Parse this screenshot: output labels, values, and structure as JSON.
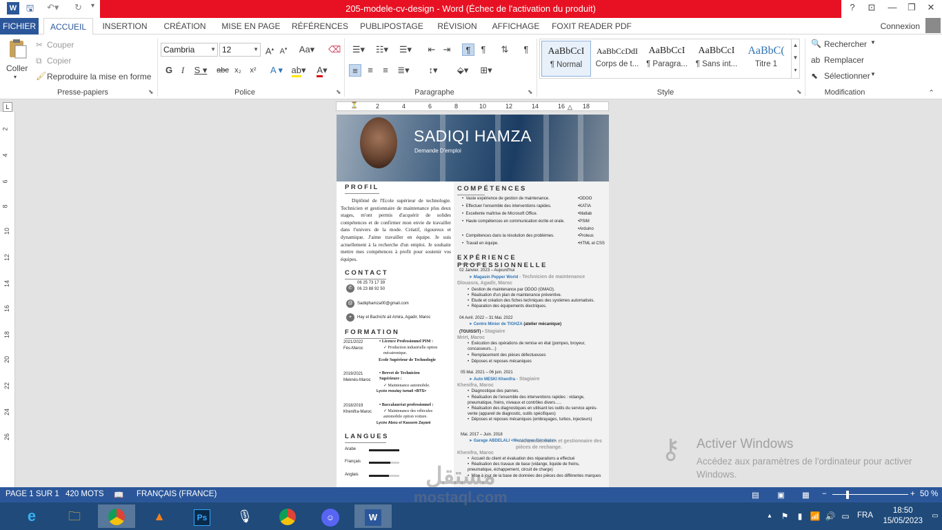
{
  "titlebar": {
    "title": "205-modele-cv-design -  Word (Échec de l'activation du produit)",
    "help": "?",
    "restore_ribbon": "⊡",
    "minimize": "—",
    "maximize": "❐",
    "close": "✕"
  },
  "tabs": {
    "file": "FICHIER",
    "items": [
      "ACCUEIL",
      "INSERTION",
      "CRÉATION",
      "MISE EN PAGE",
      "RÉFÉRENCES",
      "PUBLIPOSTAGE",
      "RÉVISION",
      "AFFICHAGE",
      "FOXIT READER PDF"
    ],
    "active": "ACCUEIL",
    "signin": "Connexion"
  },
  "ribbon": {
    "clipboard": {
      "paste": "Coller",
      "cut": "Couper",
      "copy": "Copier",
      "format_painter": "Reproduire la mise en forme",
      "label": "Presse-papiers"
    },
    "font": {
      "name": "Cambria",
      "size": "12",
      "label": "Police"
    },
    "paragraph": {
      "label": "Paragraphe"
    },
    "styles": {
      "label": "Style",
      "items": [
        {
          "sample": "AaBbCcI",
          "name": "¶ Normal"
        },
        {
          "sample": "AaBbCcDdI",
          "name": "Corps de t..."
        },
        {
          "sample": "AaBbCcI",
          "name": "¶ Paragra..."
        },
        {
          "sample": "AaBbCcI",
          "name": "¶ Sans int..."
        },
        {
          "sample": "AaBbC(",
          "name": "Titre 1"
        }
      ]
    },
    "editing": {
      "find": "Rechercher",
      "replace": "Remplacer",
      "select": "Sélectionner",
      "label": "Modification"
    }
  },
  "ruler": {
    "h_numbers": [
      "2",
      "4",
      "6",
      "8",
      "10",
      "12",
      "14",
      "16",
      "18"
    ],
    "v_numbers": [
      "2",
      "4",
      "6",
      "8",
      "10",
      "12",
      "14",
      "16",
      "18",
      "20",
      "22",
      "24",
      "26"
    ]
  },
  "cv": {
    "name": "SADIQI HAMZA",
    "subtitle": "Demande D'emploi",
    "profil_h": "PROFIL",
    "profil_text": "Diplômé de l'Ecole supérieur de technologie. Technicien et gestionnaire de maintenance plus deux stages, m'ont permis d'acquérir de solides compétences et de confirmer mon envie de travailler dans l'univers de la mode. Créatif, rigoureux et dynamique. J'aime travailler en équipe. Je suis actuellement à la recherche d'un emploi. Je souhaite mettre mes compétences à profit pour soutenir vos équipes.",
    "contact_h": "CONTACT",
    "phone1": "06 25 73 17 39",
    "phone2": "06 23 88 92 50",
    "email": "Sadiqihamza00@gmail.com",
    "address": "Hay el Bachichi ait Amira, Agadir, Maroc",
    "formation_h": "FORMATION",
    "formation": [
      {
        "years": "2021/2022",
        "place": "Fès-Maroc",
        "title": "Licence Professionnel PIM :",
        "detail": "Production industrielle option mécatronique.",
        "school": "Ecole Supérieur de Technologie"
      },
      {
        "years": "2019/2021",
        "place": "Meknès-Maroc",
        "title": "Brevet de Technicien Supérieure :",
        "detail": "Maintenance automobile.",
        "school": "Lycée moulay ismail <BTS>"
      },
      {
        "years": "2018/2019",
        "place": "Khenifra-Maroc",
        "title": "Baccalauréat professionnel :",
        "detail": "Maintenance des véhicules automobile option voiture.",
        "school": "Lycée Abou el Kassem Zayani"
      }
    ],
    "langues_h": "LANGUES",
    "langues": [
      {
        "name": "Arabe",
        "level": 1.0
      },
      {
        "name": "Français",
        "level": 0.7
      },
      {
        "name": "Anglais",
        "level": 0.65
      }
    ],
    "competences_h": "COMPÉTENCES",
    "competences": [
      "Vaste expérience de gestion de maintenance.",
      "Effectuer l'ensemble des interventions rapides.",
      "Excellente maîtrise de Microsoft Office.",
      "Haute compétences en communication écrite et orale.",
      "Compétences dans la résolution des problèmes.",
      "Travail en équipe."
    ],
    "tools": [
      "ODOO",
      "KATIA",
      "Matlab",
      "PSIM",
      "Arduino",
      "Proteus",
      "HTML et CSS"
    ],
    "experience_h": "EXPÉRIENCE PROFESSIONNELLE",
    "experiences": [
      {
        "dates": "02 Janvier. 2023 – Aujourd'hui",
        "company": "Magasin Pepper World",
        "role": "- Technicien de maintenance",
        "location": "Dlouasra, Agadir, Maroc",
        "tasks": [
          "Gestion de maintenance par ODOO (GMAO).",
          "Réalisation d'un plan de maintenance préventive.",
          "Etude et création des fiches techniques des systèmes automatisés.",
          "Réparation des équipements électriques."
        ]
      },
      {
        "dates": "04 Avril. 2022 – 31 Mai. 2022",
        "company": "Centre Minier de TIGHZA",
        "company_extra": "(atelier mécanique)",
        "extra2": "(TOUISSIT) -",
        "role": "Stagiaire",
        "location": "Mrirt, Maroc",
        "tasks": [
          "Exécution des opérations de remise en état (pompes, broyeur, concasseurs…)",
          "Remplacement des pièces défectueuses",
          "Déposes et reposes mécaniques"
        ]
      },
      {
        "dates": "05 Mai. 2021 – 06 juin. 2021",
        "company": "Auto MESKI Khenifra",
        "role": "- Stagiaire",
        "location": "Khenifra, Maroc",
        "tasks": [
          "Diagnostique des pannes.",
          "Réalisation de l'ensemble des interventions rapides : vidange, pneumatique, freins, niveaux et contrôles divers…..",
          "Réalisation des diagnostiques en utilisant les outils du service après-vente (appareil de diagnostic, outils spécifiques)",
          "Déposes et reposes mécaniques (embrayages, turbos, injecteurs)"
        ]
      },
      {
        "dates": "Mai. 2017 – Juin. 2018",
        "company": "Garage ABDELALI <Mecanique Générale>",
        "role": "- Aide mécanicien et gestionnaire des pièces de rechange.",
        "location": "Khenifra, Maroc",
        "tasks": [
          "Accueil du client et évaluation des réparations a effectué",
          "Réalisation des travaux de base (vidange, liquide de freins, pneumatique, échappement, circuit de charge)",
          "Mise à jour de la base de données des pièces des différentes marques"
        ]
      }
    ]
  },
  "statusbar": {
    "page": "PAGE 1 SUR 1",
    "words": "420 MOTS",
    "language": "FRANÇAIS (FRANCE)",
    "zoom": "50 %"
  },
  "activation": {
    "title": "Activer Windows",
    "text": "Accédez aux paramètres de l'ordinateur pour activer Windows."
  },
  "watermark": {
    "arabic": "مستقل",
    "latin": "mostaql.com"
  },
  "taskbar": {
    "lang": "FRA",
    "time": "18:50",
    "date": "15/05/2023"
  }
}
